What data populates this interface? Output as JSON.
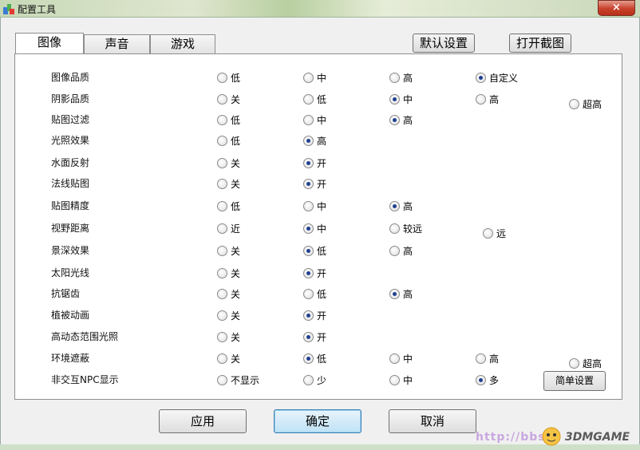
{
  "window": {
    "title": "配置工具",
    "close_label": "×"
  },
  "tabs": [
    {
      "label": "图像",
      "active": true
    },
    {
      "label": "声音",
      "active": false
    },
    {
      "label": "游戏",
      "active": false
    }
  ],
  "top_buttons": {
    "default_settings": "默认设置",
    "open_screenshot": "打开截图"
  },
  "settings": [
    {
      "label": "图像品质",
      "options": [
        {
          "text": "低",
          "checked": false
        },
        {
          "text": "中",
          "checked": false
        },
        {
          "text": "高",
          "checked": false
        },
        {
          "text": "自定义",
          "checked": true
        }
      ]
    },
    {
      "label": "阴影品质",
      "options": [
        {
          "text": "关",
          "checked": false
        },
        {
          "text": "低",
          "checked": false
        },
        {
          "text": "中",
          "checked": true
        },
        {
          "text": "高",
          "checked": false
        },
        {
          "text": "超高",
          "checked": false
        }
      ]
    },
    {
      "label": "贴图过滤",
      "options": [
        {
          "text": "低",
          "checked": false
        },
        {
          "text": "中",
          "checked": false
        },
        {
          "text": "高",
          "checked": true
        }
      ]
    },
    {
      "label": "光照效果",
      "options": [
        {
          "text": "低",
          "checked": false
        },
        {
          "text": "高",
          "checked": true
        }
      ]
    },
    {
      "label": "水面反射",
      "options": [
        {
          "text": "关",
          "checked": false
        },
        {
          "text": "开",
          "checked": true
        }
      ]
    },
    {
      "label": "法线贴图",
      "options": [
        {
          "text": "关",
          "checked": false
        },
        {
          "text": "开",
          "checked": true
        }
      ]
    },
    {
      "label": "贴图精度",
      "options": [
        {
          "text": "低",
          "checked": false
        },
        {
          "text": "中",
          "checked": false
        },
        {
          "text": "高",
          "checked": true
        }
      ]
    },
    {
      "label": "视野距离",
      "options": [
        {
          "text": "近",
          "checked": false
        },
        {
          "text": "中",
          "checked": true
        },
        {
          "text": "较远",
          "checked": false
        },
        {
          "text": "远",
          "checked": false
        }
      ]
    },
    {
      "label": "景深效果",
      "options": [
        {
          "text": "关",
          "checked": false
        },
        {
          "text": "低",
          "checked": true
        },
        {
          "text": "高",
          "checked": false
        }
      ]
    },
    {
      "label": "太阳光线",
      "options": [
        {
          "text": "关",
          "checked": false
        },
        {
          "text": "开",
          "checked": true
        }
      ]
    },
    {
      "label": "抗锯齿",
      "options": [
        {
          "text": "关",
          "checked": false
        },
        {
          "text": "低",
          "checked": false
        },
        {
          "text": "高",
          "checked": true
        }
      ]
    },
    {
      "label": "植被动画",
      "options": [
        {
          "text": "关",
          "checked": false
        },
        {
          "text": "开",
          "checked": true
        }
      ]
    },
    {
      "label": "高动态范围光照",
      "options": [
        {
          "text": "关",
          "checked": false
        },
        {
          "text": "开",
          "checked": true
        }
      ]
    },
    {
      "label": "环境遮蔽",
      "options": [
        {
          "text": "关",
          "checked": false
        },
        {
          "text": "低",
          "checked": true
        },
        {
          "text": "中",
          "checked": false
        },
        {
          "text": "高",
          "checked": false
        },
        {
          "text": "超高",
          "checked": false
        }
      ]
    },
    {
      "label": "非交互NPC显示",
      "options": [
        {
          "text": "不显示",
          "checked": false
        },
        {
          "text": "少",
          "checked": false
        },
        {
          "text": "中",
          "checked": false
        },
        {
          "text": "多",
          "checked": true
        }
      ]
    }
  ],
  "simple_settings_label": "简单设置",
  "bottom_buttons": {
    "apply": "应用",
    "ok": "确定",
    "cancel": "取消"
  },
  "watermark": {
    "url": "http://bbs.",
    "brand": "3DMGAME"
  }
}
